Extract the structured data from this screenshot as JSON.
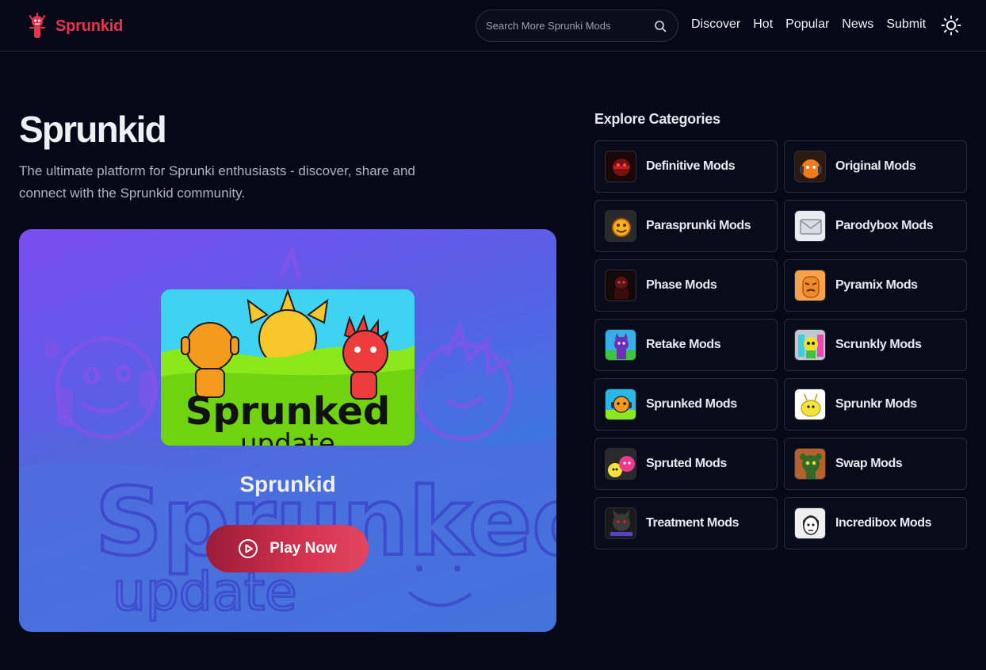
{
  "header": {
    "brand": "Sprunkid",
    "search_placeholder": "Search More Sprunki Mods",
    "nav": [
      "Discover",
      "Hot",
      "Popular",
      "News",
      "Submit"
    ]
  },
  "hero": {
    "title": "Sprunkid",
    "description": "The ultimate platform for Sprunki enthusiasts - discover, share and connect with the Sprunkid community.",
    "game_name": "Sprunkid",
    "play_label": "Play Now",
    "thumbnail_text": "Sprunked",
    "thumbnail_subtext": "update",
    "background_text": "Sprunked",
    "background_subtext": "update"
  },
  "categories": {
    "title": "Explore Categories",
    "items": [
      {
        "label": "Definitive Mods",
        "icon": "definitive-mods-icon",
        "color": "#7a1010"
      },
      {
        "label": "Original Mods",
        "icon": "original-mods-icon",
        "color": "#f07b1f"
      },
      {
        "label": "Parasprunki Mods",
        "icon": "parasprunki-mods-icon",
        "color": "#f3b21c"
      },
      {
        "label": "Parodybox Mods",
        "icon": "parodybox-mods-icon",
        "color": "#d9dde3"
      },
      {
        "label": "Phase Mods",
        "icon": "phase-mods-icon",
        "color": "#5a1414"
      },
      {
        "label": "Pyramix Mods",
        "icon": "pyramix-mods-icon",
        "color": "#f08a2a"
      },
      {
        "label": "Retake Mods",
        "icon": "retake-mods-icon",
        "color": "#6b2fb8"
      },
      {
        "label": "Scrunkly Mods",
        "icon": "scrunkly-mods-icon",
        "color": "#c0c7d2"
      },
      {
        "label": "Sprunked Mods",
        "icon": "sprunked-mods-icon",
        "color": "#2bb8e8"
      },
      {
        "label": "Sprunkr Mods",
        "icon": "sprunkr-mods-icon",
        "color": "#f5e23a"
      },
      {
        "label": "Spruted Mods",
        "icon": "spruted-mods-icon",
        "color": "#e93a8e"
      },
      {
        "label": "Swap Mods",
        "icon": "swap-mods-icon",
        "color": "#7a4a1a"
      },
      {
        "label": "Treatment Mods",
        "icon": "treatment-mods-icon",
        "color": "#3a3a3a"
      },
      {
        "label": "Incredibox Mods",
        "icon": "incredibox-mods-icon",
        "color": "#f0f0f0"
      }
    ]
  },
  "colors": {
    "accent": "#e8324f",
    "background": "#060817",
    "card_border": "#272c3b"
  }
}
